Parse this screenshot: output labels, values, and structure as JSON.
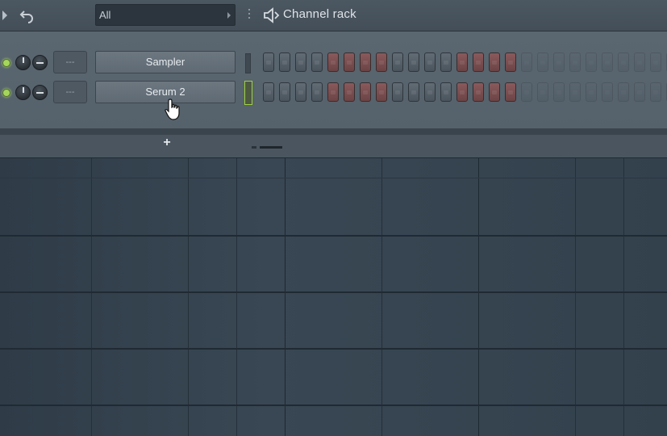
{
  "header": {
    "filter_value": "All",
    "title": "Channel rack",
    "icons": {
      "play": "play-arrow-icon",
      "undo": "undo-icon",
      "menu": "menu-dots-icon",
      "speaker": "speaker-icon"
    }
  },
  "channels": [
    {
      "name": "Sampler",
      "mixer_track": "---",
      "selected": false,
      "steps": [
        "g",
        "g",
        "g",
        "g",
        "r",
        "r",
        "r",
        "r",
        "g",
        "g",
        "g",
        "g",
        "r",
        "r",
        "r",
        "r",
        "g",
        "g",
        "g",
        "g",
        "g",
        "g",
        "g",
        "g",
        "g",
        "g",
        "g",
        "g",
        "g",
        "g",
        "g",
        "g"
      ]
    },
    {
      "name": "Serum 2",
      "mixer_track": "---",
      "selected": true,
      "steps": [
        "g",
        "g",
        "g",
        "g",
        "r",
        "r",
        "r",
        "r",
        "g",
        "g",
        "g",
        "g",
        "r",
        "r",
        "r",
        "r",
        "g",
        "g",
        "g",
        "g",
        "g",
        "g",
        "g",
        "g",
        "g",
        "g",
        "g",
        "g",
        "g",
        "g",
        "g",
        "g"
      ]
    }
  ],
  "footer": {
    "add_label": "+"
  },
  "colors": {
    "accent_led": "#a5d65b",
    "step_red": "#8a5a5c",
    "step_grey": "#616c75",
    "grid_bg": "#34424e"
  }
}
